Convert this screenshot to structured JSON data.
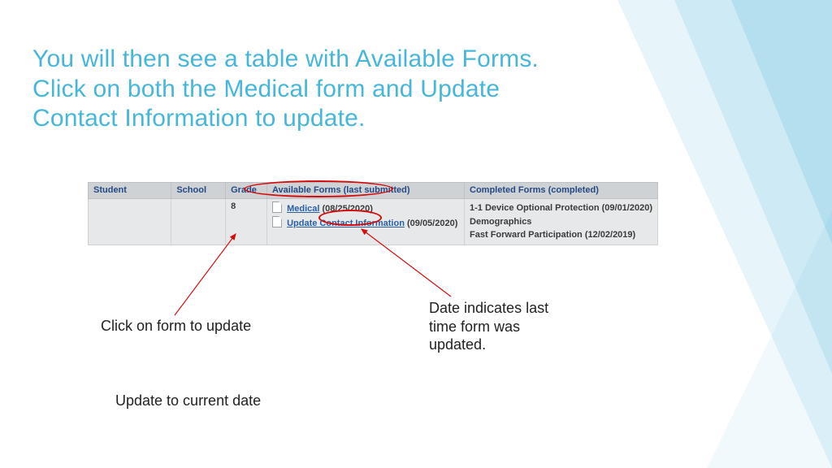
{
  "title": "You will then see a table with Available Forms. Click on both the Medical form and Update Contact Information to update.",
  "table": {
    "headers": {
      "student": "Student",
      "school": "School",
      "grade": "Grade",
      "available": "Available Forms (last submitted)",
      "completed": "Completed Forms (completed)"
    },
    "row": {
      "student": "",
      "school": "",
      "grade": "8",
      "available_forms": [
        {
          "name": "Medical",
          "date": "(08/25/2020)"
        },
        {
          "name": "Update Contact Information",
          "date": "(09/05/2020)"
        }
      ],
      "completed_forms": [
        "1-1 Device Optional Protection (09/01/2020)",
        "Demographics",
        "Fast Forward Participation (12/02/2019)"
      ]
    }
  },
  "callouts": {
    "click_form": "Click on form to update",
    "date_meaning": "Date indicates last time form was updated.",
    "update_current": "Update to current date"
  }
}
